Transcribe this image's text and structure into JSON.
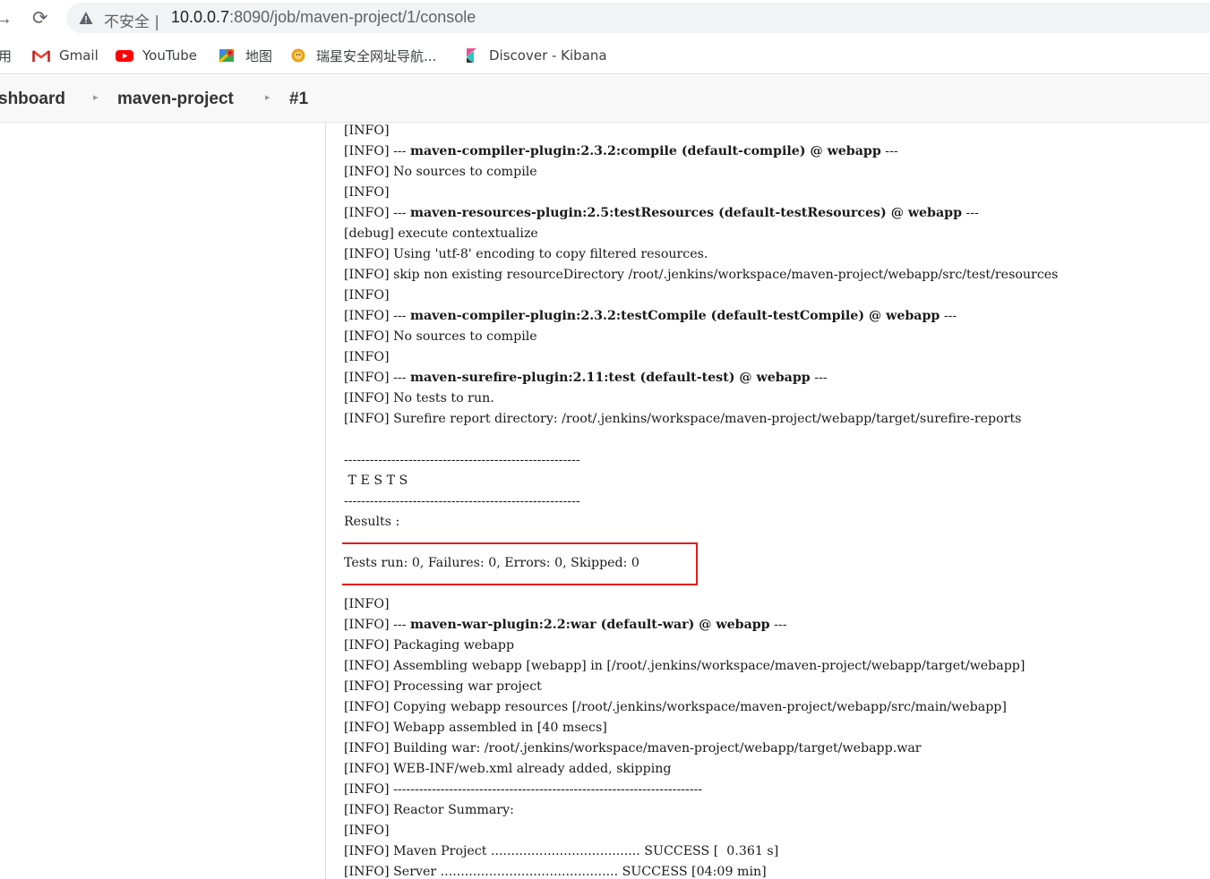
{
  "browser": {
    "address": {
      "security_label": "不安全  |",
      "host": "10.0.0.7",
      "path": ":8090/job/maven-project/1/console"
    },
    "bookmarks": [
      {
        "label": "用",
        "icon": "apps-icon"
      },
      {
        "label": "Gmail",
        "icon": "gmail-icon"
      },
      {
        "label": "YouTube",
        "icon": "youtube-icon"
      },
      {
        "label": "地图",
        "icon": "maps-icon"
      },
      {
        "label": "瑞星安全网址导航...",
        "icon": "rising-lion-icon"
      },
      {
        "label": "Discover - Kibana",
        "icon": "kibana-icon"
      }
    ]
  },
  "breadcrumbs": {
    "dashboard": "shboard",
    "project": "maven-project",
    "build": "#1"
  },
  "console": {
    "lines": [
      {
        "prefix": "[INFO]",
        "bold": "",
        "suffix": ""
      },
      {
        "prefix": "[INFO] --- ",
        "bold": "maven-compiler-plugin:2.3.2:compile (default-compile) @ webapp",
        "suffix": " ---"
      },
      {
        "prefix": "[INFO] No sources to compile",
        "bold": "",
        "suffix": ""
      },
      {
        "prefix": "[INFO]",
        "bold": "",
        "suffix": ""
      },
      {
        "prefix": "[INFO] --- ",
        "bold": "maven-resources-plugin:2.5:testResources (default-testResources) @ webapp",
        "suffix": " ---"
      },
      {
        "prefix": "[debug] execute contextualize",
        "bold": "",
        "suffix": ""
      },
      {
        "prefix": "[INFO] Using 'utf-8' encoding to copy filtered resources.",
        "bold": "",
        "suffix": ""
      },
      {
        "prefix": "[INFO] skip non existing resourceDirectory /root/.jenkins/workspace/maven-project/webapp/src/test/resources",
        "bold": "",
        "suffix": ""
      },
      {
        "prefix": "[INFO]",
        "bold": "",
        "suffix": ""
      },
      {
        "prefix": "[INFO] --- ",
        "bold": "maven-compiler-plugin:2.3.2:testCompile (default-testCompile) @ webapp",
        "suffix": " ---"
      },
      {
        "prefix": "[INFO] No sources to compile",
        "bold": "",
        "suffix": ""
      },
      {
        "prefix": "[INFO]",
        "bold": "",
        "suffix": ""
      },
      {
        "prefix": "[INFO] --- ",
        "bold": "maven-surefire-plugin:2.11:test (default-test) @ webapp",
        "suffix": " ---"
      },
      {
        "prefix": "[INFO] No tests to run.",
        "bold": "",
        "suffix": ""
      },
      {
        "prefix": "[INFO] Surefire report directory: /root/.jenkins/workspace/maven-project/webapp/target/surefire-reports",
        "bold": "",
        "suffix": ""
      },
      {
        "prefix": "",
        "bold": "",
        "suffix": ""
      },
      {
        "prefix": "-------------------------------------------------------",
        "bold": "",
        "suffix": ""
      },
      {
        "prefix": " T E S T S",
        "bold": "",
        "suffix": ""
      },
      {
        "prefix": "-------------------------------------------------------",
        "bold": "",
        "suffix": ""
      },
      {
        "prefix": "Results :",
        "bold": "",
        "suffix": ""
      },
      {
        "prefix": "",
        "bold": "",
        "suffix": ""
      },
      {
        "prefix": "Tests run: 0, Failures: 0, Errors: 0, Skipped: 0",
        "bold": "",
        "suffix": ""
      },
      {
        "prefix": "",
        "bold": "",
        "suffix": ""
      },
      {
        "prefix": "[INFO]",
        "bold": "",
        "suffix": ""
      },
      {
        "prefix": "[INFO] --- ",
        "bold": "maven-war-plugin:2.2:war (default-war) @ webapp",
        "suffix": " ---"
      },
      {
        "prefix": "[INFO] Packaging webapp",
        "bold": "",
        "suffix": ""
      },
      {
        "prefix": "[INFO] Assembling webapp [webapp] in [/root/.jenkins/workspace/maven-project/webapp/target/webapp]",
        "bold": "",
        "suffix": ""
      },
      {
        "prefix": "[INFO] Processing war project",
        "bold": "",
        "suffix": ""
      },
      {
        "prefix": "[INFO] Copying webapp resources [/root/.jenkins/workspace/maven-project/webapp/src/main/webapp]",
        "bold": "",
        "suffix": ""
      },
      {
        "prefix": "[INFO] Webapp assembled in [40 msecs]",
        "bold": "",
        "suffix": ""
      },
      {
        "prefix": "[INFO] Building war: /root/.jenkins/workspace/maven-project/webapp/target/webapp.war",
        "bold": "",
        "suffix": ""
      },
      {
        "prefix": "[INFO] WEB-INF/web.xml already added, skipping",
        "bold": "",
        "suffix": ""
      },
      {
        "prefix": "[INFO] ------------------------------------------------------------------------",
        "bold": "",
        "suffix": ""
      },
      {
        "prefix": "[INFO] Reactor Summary:",
        "bold": "",
        "suffix": ""
      },
      {
        "prefix": "[INFO]",
        "bold": "",
        "suffix": ""
      },
      {
        "prefix": "[INFO] Maven Project ..................................... SUCCESS [  0.361 s]",
        "bold": "",
        "suffix": ""
      },
      {
        "prefix": "[INFO] Server ............................................ SUCCESS [04:09 min]",
        "bold": "",
        "suffix": ""
      }
    ]
  },
  "colors": {
    "highlight_box": "#e31b1b",
    "youtube_red": "#ff0000",
    "gmail_red": "#ea4335"
  }
}
